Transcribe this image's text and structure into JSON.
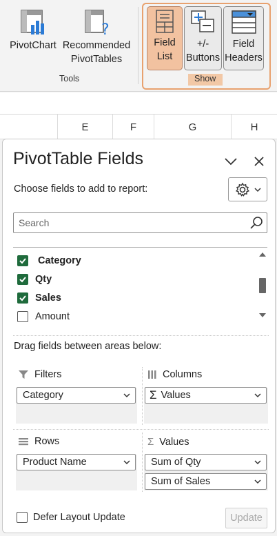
{
  "ribbon": {
    "tools": {
      "pivotchart_label": "PivotChart",
      "recommended_line1": "Recommended",
      "recommended_line2": "PivotTables",
      "group_label": "Tools"
    },
    "show": {
      "field_list_line1": "Field",
      "field_list_line2": "List",
      "buttons_line1": "+/-",
      "buttons_line2": "Buttons",
      "headers_line1": "Field",
      "headers_line2": "Headers",
      "group_label": "Show"
    },
    "accent_color": "#e8a16e",
    "active_button_color": "#f2c2a0"
  },
  "sheet": {
    "columns": [
      "E",
      "F",
      "G",
      "H"
    ]
  },
  "pane": {
    "title": "PivotTable Fields",
    "subtitle": "Choose fields to add to report:",
    "search_placeholder": "Search",
    "fields": [
      {
        "name": "Category",
        "checked": true
      },
      {
        "name": "Qty",
        "checked": true
      },
      {
        "name": "Sales",
        "checked": true
      },
      {
        "name": "Amount",
        "checked": false
      }
    ],
    "drag_label": "Drag fields between areas below:",
    "areas": {
      "filters": {
        "label": "Filters",
        "items": [
          "Category"
        ]
      },
      "columns": {
        "label": "Columns",
        "items": [
          "Values"
        ]
      },
      "rows": {
        "label": "Rows",
        "items": [
          "Product Name"
        ]
      },
      "values": {
        "label": "Values",
        "items": [
          "Sum of Qty",
          "Sum of Sales"
        ]
      }
    },
    "defer_label": "Defer Layout Update",
    "update_label": "Update",
    "check_color": "#1f6b3c"
  }
}
